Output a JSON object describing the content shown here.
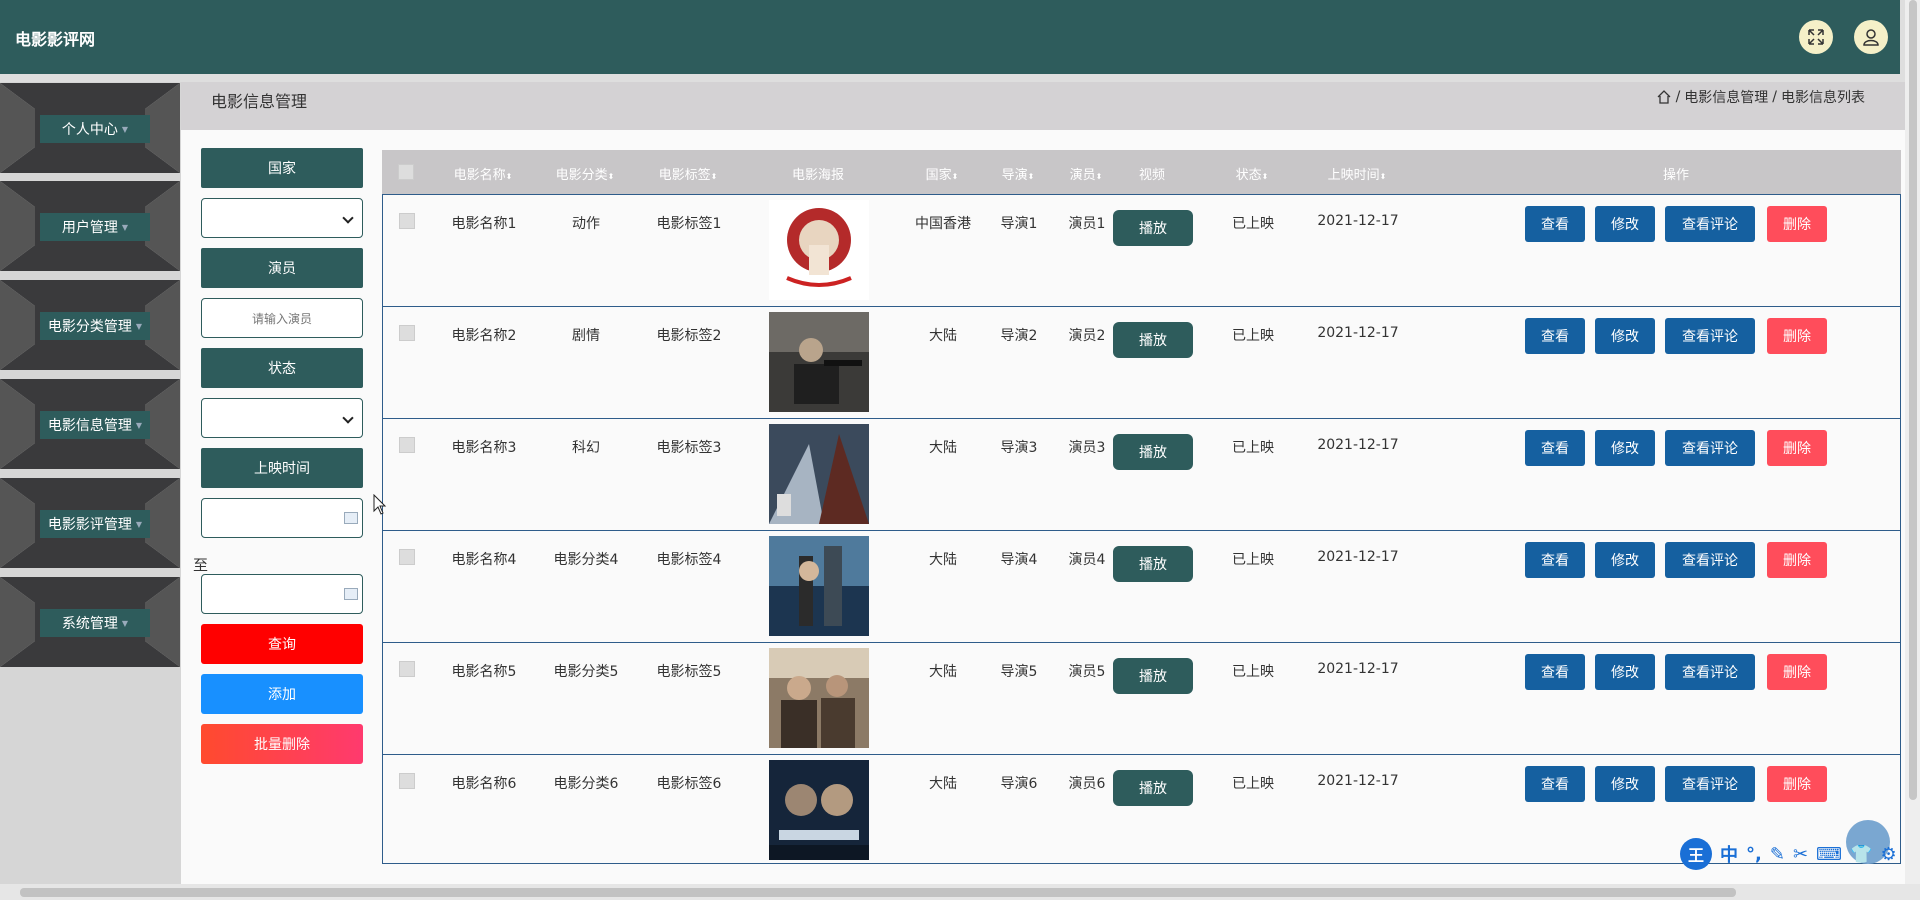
{
  "app": {
    "title": "电影影评网"
  },
  "header_icons": [
    "fullscreen-icon",
    "user-icon"
  ],
  "sidebar": {
    "items": [
      {
        "label": "个人中心"
      },
      {
        "label": "用户管理"
      },
      {
        "label": "电影分类管理"
      },
      {
        "label": "电影信息管理"
      },
      {
        "label": "电影影评管理"
      },
      {
        "label": "系统管理"
      }
    ]
  },
  "page": {
    "title": "电影信息管理",
    "breadcrumb": [
      "电影信息管理",
      "电影信息列表"
    ],
    "breadcrumb_sep": "/"
  },
  "filters": {
    "country_label": "国家",
    "actor_label": "演员",
    "actor_placeholder": "请输入演员",
    "status_label": "状态",
    "release_label": "上映时间",
    "to_label": "至",
    "query_btn": "查询",
    "add_btn": "添加",
    "batch_delete_btn": "批量删除"
  },
  "table": {
    "columns": [
      "电影名称",
      "电影分类",
      "电影标签",
      "电影海报",
      "国家",
      "导演",
      "演员",
      "视频",
      "状态",
      "上映时间",
      "操作"
    ],
    "rows": [
      {
        "name": "电影名称1",
        "category": "动作",
        "tag": "电影标签1",
        "country": "中国香港",
        "director": "导演1",
        "actor": "演员1",
        "status": "已上映",
        "date": "2021-12-17"
      },
      {
        "name": "电影名称2",
        "category": "剧情",
        "tag": "电影标签2",
        "country": "大陆",
        "director": "导演2",
        "actor": "演员2",
        "status": "已上映",
        "date": "2021-12-17"
      },
      {
        "name": "电影名称3",
        "category": "科幻",
        "tag": "电影标签3",
        "country": "大陆",
        "director": "导演3",
        "actor": "演员3",
        "status": "已上映",
        "date": "2021-12-17"
      },
      {
        "name": "电影名称4",
        "category": "电影分类4",
        "tag": "电影标签4",
        "country": "大陆",
        "director": "导演4",
        "actor": "演员4",
        "status": "已上映",
        "date": "2021-12-17"
      },
      {
        "name": "电影名称5",
        "category": "电影分类5",
        "tag": "电影标签5",
        "country": "大陆",
        "director": "导演5",
        "actor": "演员5",
        "status": "已上映",
        "date": "2021-12-17"
      },
      {
        "name": "电影名称6",
        "category": "电影分类6",
        "tag": "电影标签6",
        "country": "大陆",
        "director": "导演6",
        "actor": "演员6",
        "status": "已上映",
        "date": "2021-12-17"
      }
    ],
    "play_btn": "播放",
    "actions": {
      "view": "查看",
      "edit": "修改",
      "comments": "查看评论",
      "delete": "删除"
    }
  },
  "ime": {
    "logo": "王",
    "mode": "中"
  },
  "colors": {
    "primary": "#2e5c5c",
    "action_blue": "#1560a0",
    "delete_red": "#ff4d5b",
    "query_red": "#ff0000",
    "add_blue": "#1890ff",
    "batch_delete": "#ff4040"
  }
}
